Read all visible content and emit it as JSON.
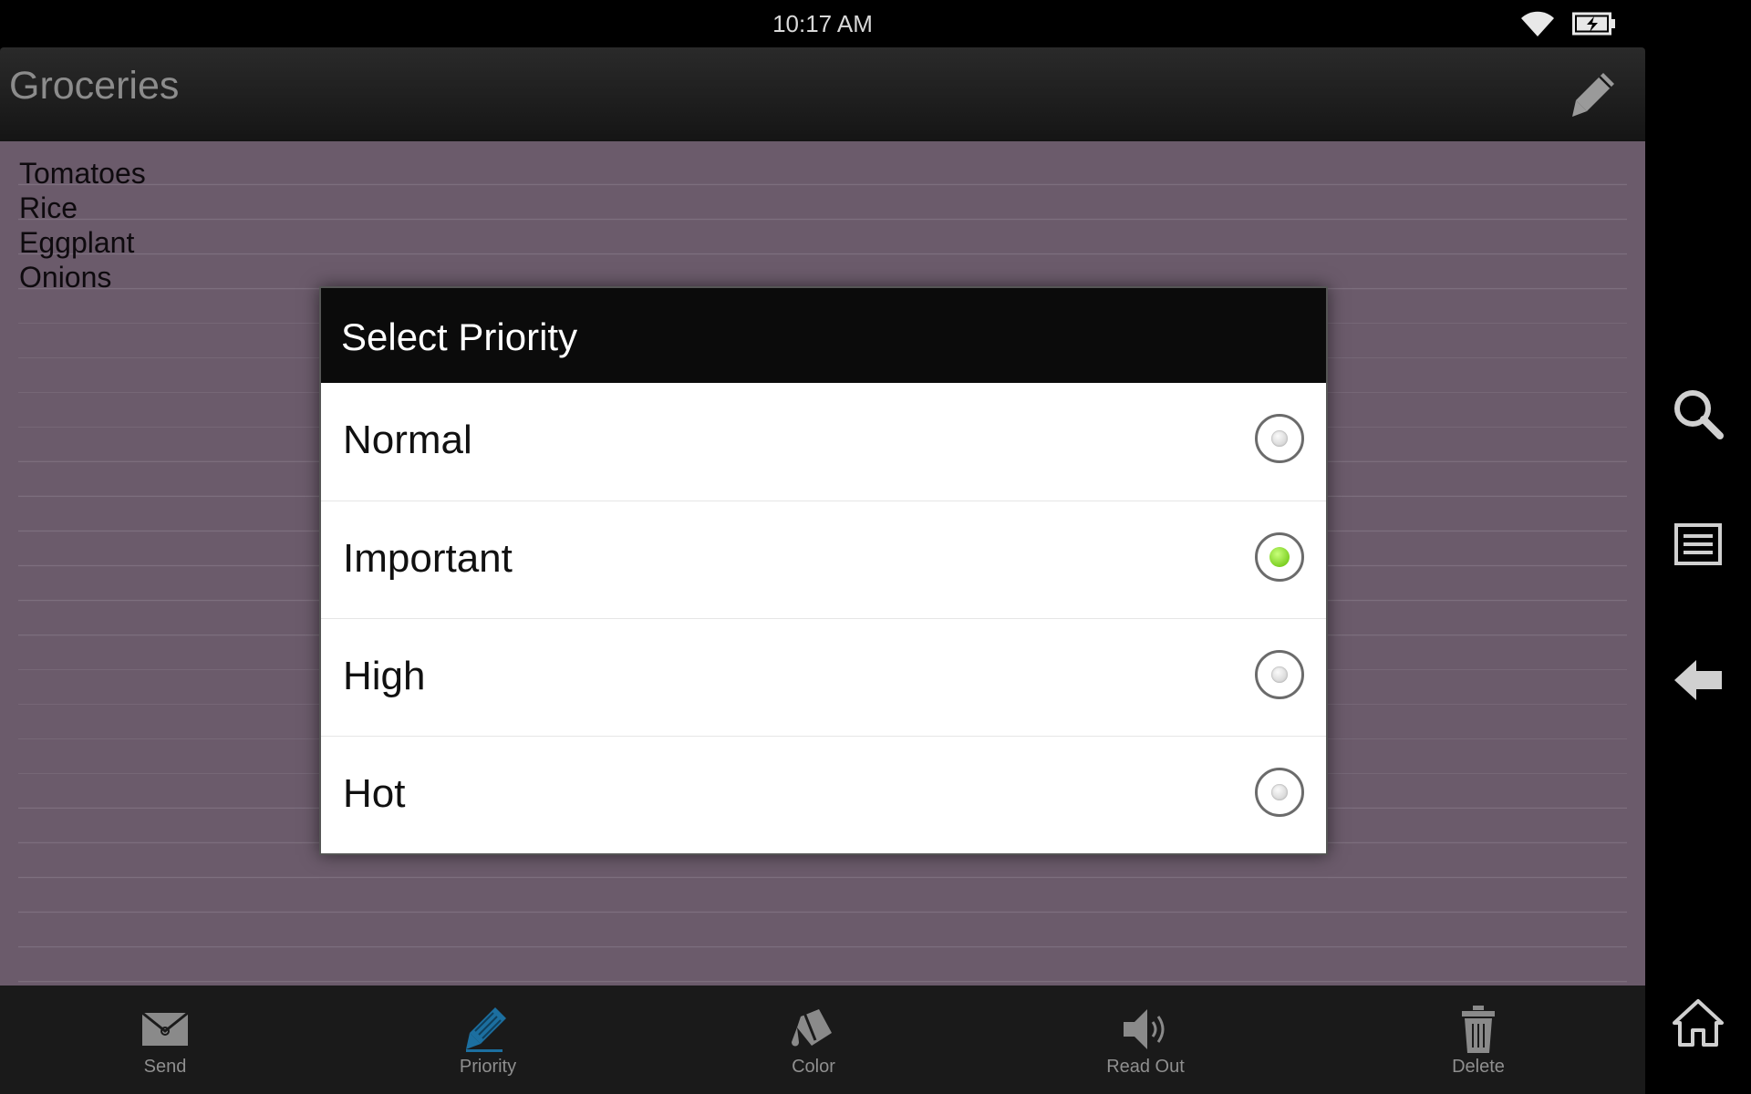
{
  "status_bar": {
    "time": "10:17 AM"
  },
  "app": {
    "title": "Groceries"
  },
  "note": {
    "lines": [
      "Tomatoes",
      "Rice",
      "Eggplant",
      "Onions"
    ]
  },
  "dialog": {
    "title": "Select Priority",
    "options": [
      {
        "label": "Normal",
        "selected": false
      },
      {
        "label": "Important",
        "selected": true
      },
      {
        "label": "High",
        "selected": false
      },
      {
        "label": "Hot",
        "selected": false
      }
    ]
  },
  "toolbar": {
    "items": [
      {
        "label": "Send",
        "icon": "envelope-icon"
      },
      {
        "label": "Priority",
        "icon": "priority-icon",
        "active": true
      },
      {
        "label": "Color",
        "icon": "paint-bucket-icon"
      },
      {
        "label": "Read Out",
        "icon": "speaker-icon"
      },
      {
        "label": "Delete",
        "icon": "trash-icon"
      }
    ]
  },
  "colors": {
    "note_background": "#6b5b6b",
    "priority_accent": "#1c6fa0",
    "selected_radio": "#5fbd00"
  }
}
